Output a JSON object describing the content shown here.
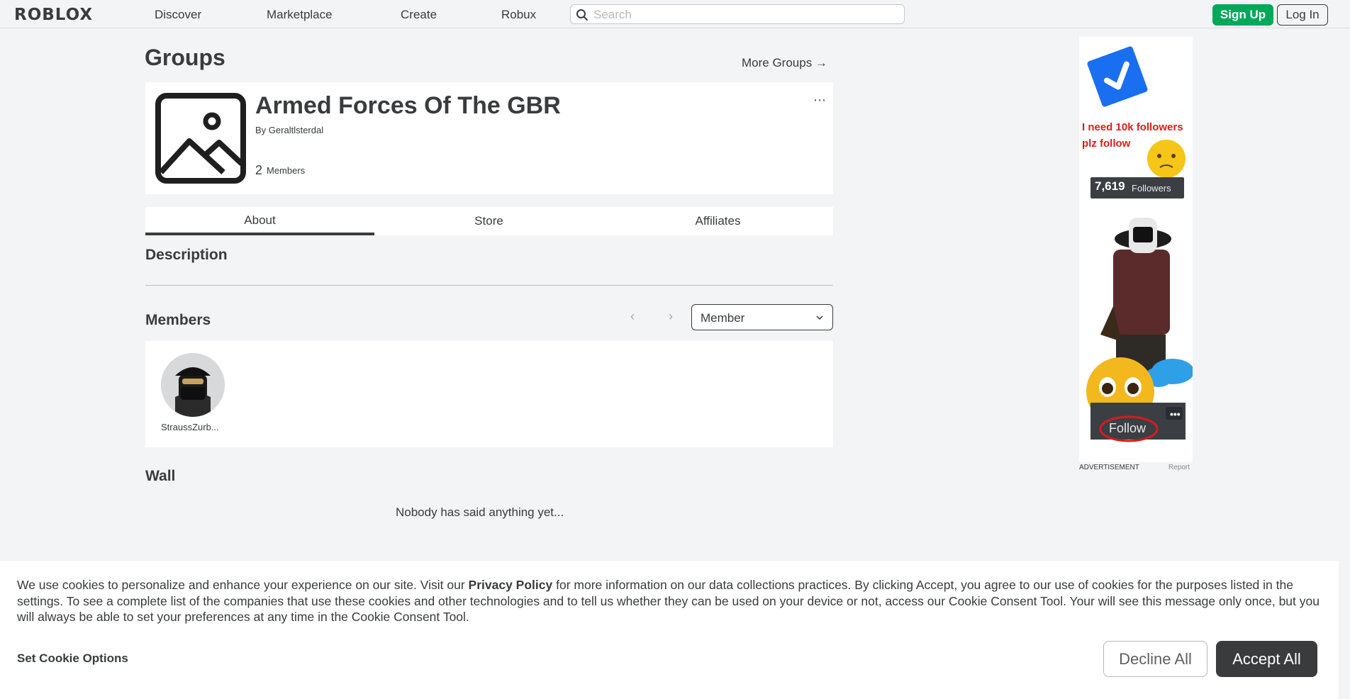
{
  "nav": {
    "logo": "ROBLOX",
    "links": [
      "Discover",
      "Marketplace",
      "Create",
      "Robux"
    ],
    "search_placeholder": "Search",
    "signup": "Sign Up",
    "login": "Log In"
  },
  "page": {
    "title": "Groups",
    "more_groups": "More Groups →"
  },
  "group": {
    "name": "Armed Forces Of The GBR",
    "by_prefix": "By",
    "owner": "Geraltlsterdal",
    "member_count": "2",
    "member_label": "Members",
    "menu": "⋯"
  },
  "tabs": [
    "About",
    "Store",
    "Affiliates"
  ],
  "description": {
    "heading": "Description"
  },
  "members": {
    "heading": "Members",
    "prev": "‹",
    "next": "›",
    "role": "Member",
    "list": [
      {
        "name": "StraussZurb..."
      }
    ]
  },
  "wall": {
    "heading": "Wall",
    "empty": "Nobody has said anything yet..."
  },
  "ad": {
    "text": "I need 10k followers plz follow",
    "followers_count": "7,619",
    "followers_label": "Followers",
    "follow": "Follow",
    "caption": "ADVERTISEMENT",
    "report": "Report"
  },
  "cookie": {
    "text_1": "We use cookies to personalize and enhance your experience on our site. Visit our ",
    "privacy": "Privacy Policy",
    "text_2": " for more information on our data collections practices. By clicking Accept, you agree to our use of cookies for the purposes listed in the settings. To see a complete list of the companies that use these cookies and other technologies and to tell us whether they can be used on your device or not, access our Cookie Consent Tool. Your will see this message only once, but you will always be able to set your preferences at any time in the Cookie Consent Tool.",
    "options": "Set Cookie Options",
    "decline": "Decline All",
    "accept": "Accept All"
  },
  "colors": {
    "accent_green": "#00a85a",
    "text": "#393b3d",
    "background": "#f2f4f5"
  }
}
